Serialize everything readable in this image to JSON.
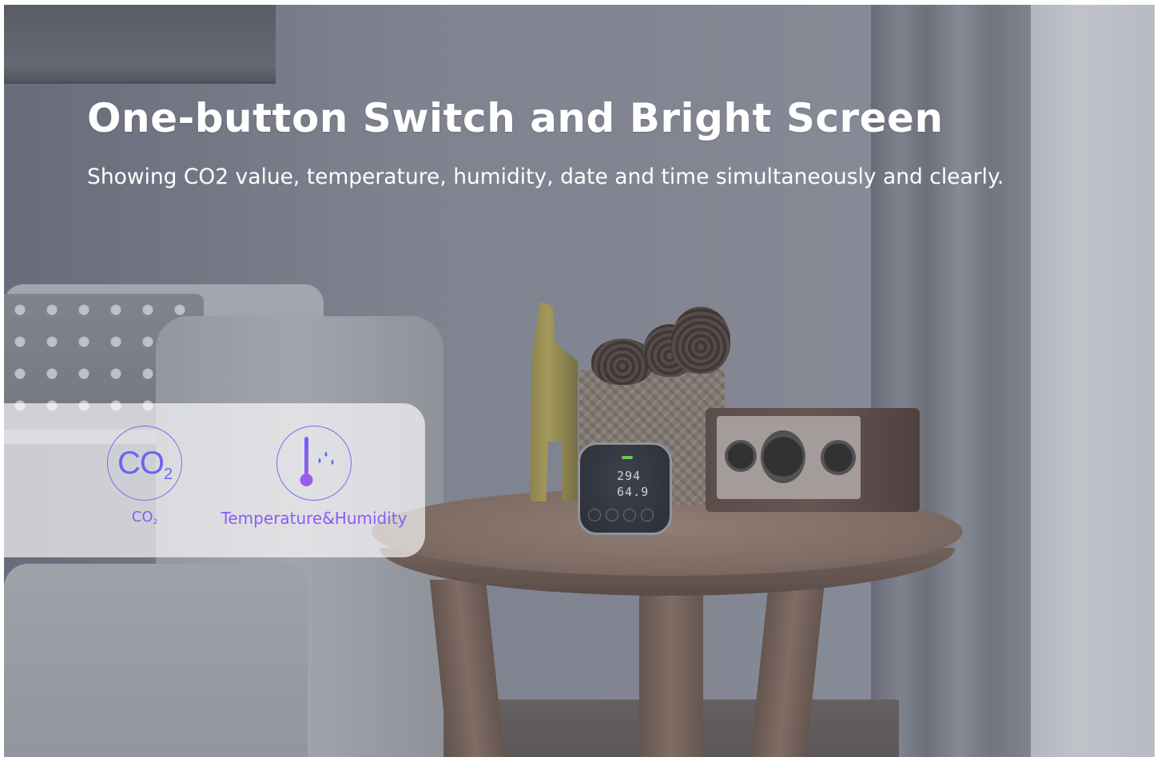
{
  "hero": {
    "title": "One-button Switch and Bright Screen",
    "subtitle": "Showing CO2 value, temperature, humidity, date and time simultaneously and clearly."
  },
  "features": [
    {
      "icon": "co2-icon",
      "icon_text": "CO",
      "icon_sub": "2",
      "label": "CO",
      "label_sub": "2"
    },
    {
      "icon": "thermometer-humidity-icon",
      "label": "Temperature&Humidity"
    }
  ],
  "device_display": {
    "line1": "294",
    "line2": "64.9"
  },
  "colors": {
    "accent": "#6d63f2",
    "label": "#8a5cf3",
    "panel": "rgba(255,255,255,0.66)"
  }
}
